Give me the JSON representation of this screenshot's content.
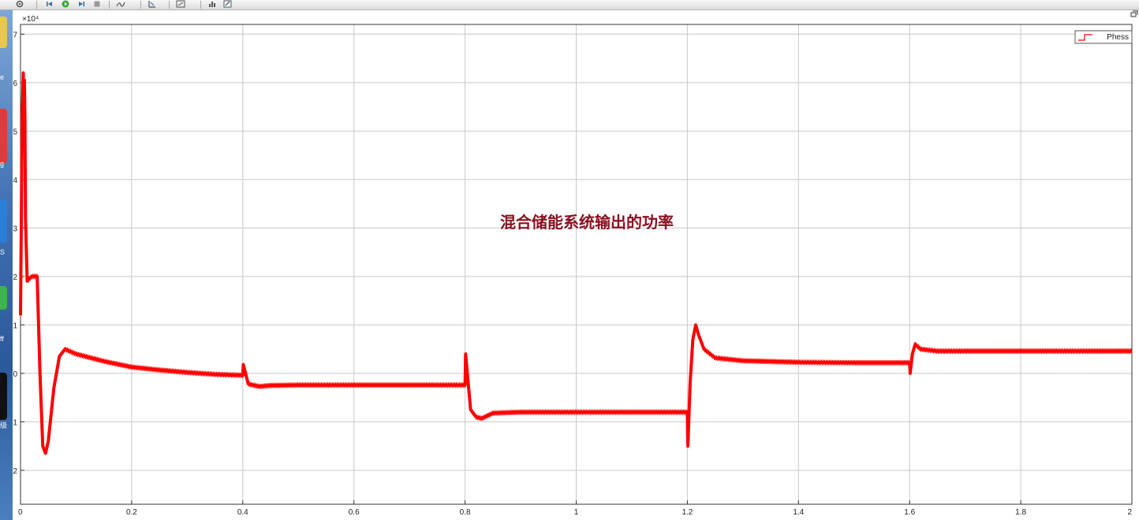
{
  "toolbar": {
    "buttons": [
      {
        "icon": "settings-gear-icon"
      },
      {
        "icon": "step-back-icon"
      },
      {
        "icon": "run-icon"
      },
      {
        "icon": "step-forward-icon"
      },
      {
        "icon": "stop-icon"
      },
      {
        "icon": "highlight-icon"
      },
      {
        "icon": "cursor-measure-icon"
      },
      {
        "icon": "zoom-fit-icon"
      },
      {
        "icon": "signal-stats-icon"
      },
      {
        "icon": "edit-style-icon"
      }
    ]
  },
  "strip_labels": [
    "e",
    "g",
    "S",
    "ff",
    "级"
  ],
  "chart_data": {
    "type": "line",
    "exponent_label": "×10⁴",
    "annotation": "混合储能系统输出的功率",
    "xlim": [
      0,
      2
    ],
    "ylim": [
      -2.7,
      7.2
    ],
    "xticks": [
      0,
      0.2,
      0.4,
      0.6,
      0.8,
      1,
      1.2,
      1.4,
      1.6,
      1.8,
      2
    ],
    "xtick_labels": [
      "0",
      "0.2",
      "0.4",
      "0.6",
      "0.8",
      "1",
      "1.2",
      "1.4",
      "1.6",
      "1.8",
      "2"
    ],
    "yticks": [
      -2,
      -1,
      0,
      1,
      2,
      3,
      4,
      5,
      6,
      7
    ],
    "ytick_labels": [
      "-2",
      "-1",
      "0",
      "1",
      "2",
      "3",
      "4",
      "5",
      "6",
      "7"
    ],
    "grid": true,
    "legend_position": "top-right",
    "series": [
      {
        "name": "Phess",
        "color": "#ff0000",
        "x": [
          0,
          0.003,
          0.005,
          0.006,
          0.007,
          0.008,
          0.009,
          0.012,
          0.015,
          0.018,
          0.02,
          0.025,
          0.03,
          0.035,
          0.04,
          0.045,
          0.05,
          0.06,
          0.07,
          0.08,
          0.1,
          0.15,
          0.2,
          0.25,
          0.3,
          0.35,
          0.4,
          0.401,
          0.41,
          0.43,
          0.45,
          0.5,
          0.6,
          0.7,
          0.8,
          0.801,
          0.81,
          0.82,
          0.83,
          0.85,
          0.9,
          1.0,
          1.1,
          1.2,
          1.201,
          1.205,
          1.21,
          1.215,
          1.22,
          1.23,
          1.25,
          1.3,
          1.4,
          1.5,
          1.6,
          1.601,
          1.605,
          1.61,
          1.62,
          1.65,
          1.7,
          1.8,
          1.9,
          2.0
        ],
        "y": [
          1.2,
          5.2,
          6.2,
          5.5,
          6.05,
          5.3,
          3.2,
          1.9,
          1.95,
          1.97,
          2.0,
          2.0,
          2.0,
          0.0,
          -1.5,
          -1.65,
          -1.4,
          -0.3,
          0.35,
          0.5,
          0.4,
          0.25,
          0.13,
          0.07,
          0.02,
          -0.02,
          -0.04,
          0.18,
          -0.22,
          -0.27,
          -0.25,
          -0.24,
          -0.24,
          -0.24,
          -0.24,
          0.4,
          -0.75,
          -0.9,
          -0.93,
          -0.82,
          -0.8,
          -0.8,
          -0.8,
          -0.8,
          -1.5,
          -0.2,
          0.7,
          1.0,
          0.8,
          0.5,
          0.32,
          0.26,
          0.23,
          0.22,
          0.22,
          0.0,
          0.4,
          0.6,
          0.5,
          0.46,
          0.46,
          0.46,
          0.46,
          0.46
        ]
      }
    ]
  }
}
